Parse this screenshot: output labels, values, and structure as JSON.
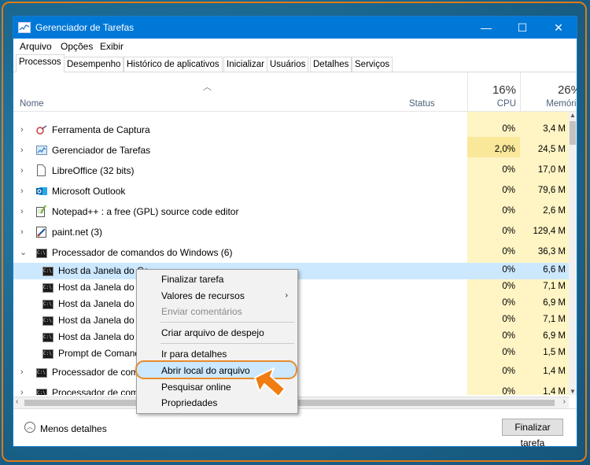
{
  "window": {
    "title": "Gerenciador de Tarefas",
    "minimize": "—",
    "maximize": "☐",
    "close": "✕"
  },
  "menu": [
    "Arquivo",
    "Opções",
    "Exibir"
  ],
  "tabs": [
    "Processos",
    "Desempenho",
    "Histórico de aplicativos",
    "Inicializar",
    "Usuários",
    "Detalhes",
    "Serviços"
  ],
  "header": {
    "name": "Nome",
    "status": "Status",
    "cpu_pct": "16%",
    "cpu_label": "CPU",
    "mem_pct": "26%",
    "mem_label": "Memória"
  },
  "rows": [
    {
      "name": "Ferramenta de Captura",
      "cpu": "0%",
      "mem": "3,4 M",
      "icon": "snipping-tool-icon"
    },
    {
      "name": "Gerenciador de Tarefas",
      "cpu": "2,0%",
      "mem": "24,5 M",
      "icon": "task-manager-icon"
    },
    {
      "name": "LibreOffice (32 bits)",
      "cpu": "0%",
      "mem": "17,0 M",
      "icon": "libreoffice-icon"
    },
    {
      "name": "Microsoft Outlook",
      "cpu": "0%",
      "mem": "79,6 M",
      "icon": "outlook-icon"
    },
    {
      "name": "Notepad++ : a free (GPL) source code editor",
      "cpu": "0%",
      "mem": "2,6 M",
      "icon": "notepadpp-icon"
    },
    {
      "name": "paint.net (3)",
      "cpu": "0%",
      "mem": "129,4 M",
      "icon": "paintnet-icon"
    },
    {
      "name": "Processador de comandos do Windows (6)",
      "cpu": "0%",
      "mem": "36,3 M",
      "icon": "cmd-icon"
    },
    {
      "name": "Host da Janela do Co",
      "cpu": "0%",
      "mem": "6,6 M",
      "icon": "cmd-icon"
    },
    {
      "name": "Host da Janela do Co",
      "cpu": "0%",
      "mem": "7,1 M",
      "icon": "cmd-icon"
    },
    {
      "name": "Host da Janela do Co",
      "cpu": "0%",
      "mem": "6,9 M",
      "icon": "cmd-icon"
    },
    {
      "name": "Host da Janela do Co",
      "cpu": "0%",
      "mem": "7,1 M",
      "icon": "cmd-icon"
    },
    {
      "name": "Host da Janela do Co",
      "cpu": "0%",
      "mem": "6,9 M",
      "icon": "cmd-icon"
    },
    {
      "name": "Prompt de Comand",
      "cpu": "0%",
      "mem": "1,5 M",
      "icon": "cmd-icon"
    },
    {
      "name": "Processador de coma",
      "cpu": "0%",
      "mem": "1,4 M",
      "icon": "cmd-icon"
    },
    {
      "name": "Processador de coma",
      "cpu": "0%",
      "mem": "1,4 M",
      "icon": "cmd-icon"
    }
  ],
  "context_menu": {
    "items": [
      {
        "label": "Finalizar tarefa",
        "enabled": true
      },
      {
        "label": "Valores de recursos",
        "enabled": true,
        "submenu": true
      },
      {
        "label": "Enviar comentários",
        "enabled": false
      },
      {
        "label": "Criar arquivo de despejo",
        "enabled": true
      },
      {
        "label": "Ir para detalhes",
        "enabled": true
      },
      {
        "label": "Abrir local do arquivo",
        "enabled": true,
        "highlighted": true
      },
      {
        "label": "Pesquisar online",
        "enabled": true
      },
      {
        "label": "Propriedades",
        "enabled": true
      }
    ]
  },
  "footer": {
    "fewer_details": "Menos detalhes",
    "end_task": "Finalizar tarefa"
  },
  "colors": {
    "titlebar": "#0078d7",
    "highlight_outline": "#e98a2a",
    "selection": "#cce8ff",
    "cpu_column": "#fff4c4"
  }
}
